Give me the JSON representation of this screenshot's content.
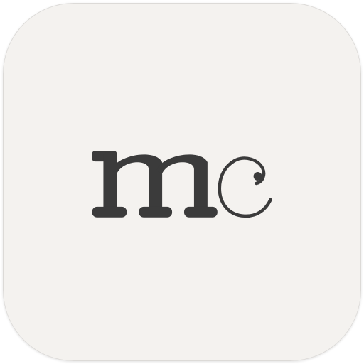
{
  "icon": {
    "monogram": "mc",
    "background_color": "#f4f2ef",
    "glyph_color": "#3b3b3b"
  }
}
